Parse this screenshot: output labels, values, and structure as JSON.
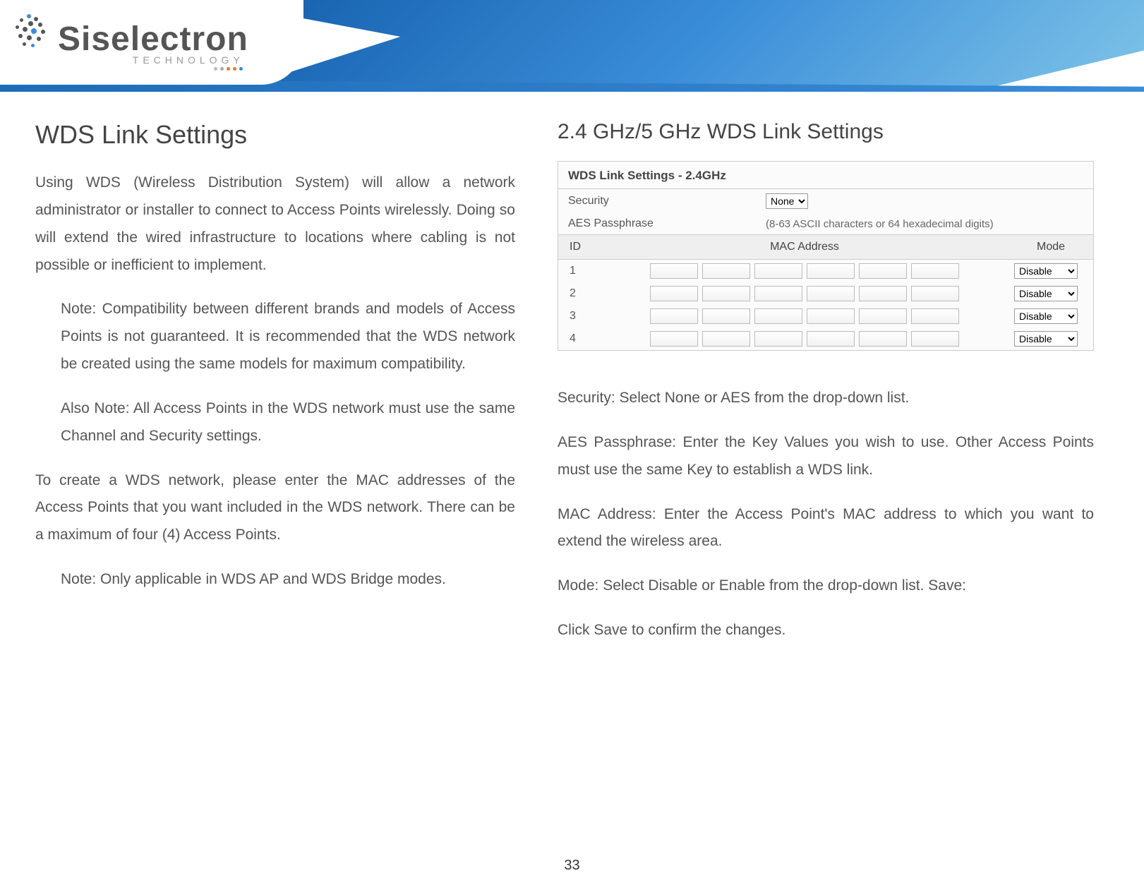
{
  "brand": {
    "name": "Siselectron",
    "tagline": "TECHNOLOGY"
  },
  "left": {
    "title": "WDS Link Settings",
    "p1": "Using   WDS  (Wireless    Distribution    System)    will  allow a    network administrator     or     installer      to      connect     to Access   Points wirelessly.    Doing   so    will extend  the    wired infrastructure  to locations where  cabling  is not  possible  or inefficient to implement.",
    "note1": "Note:    Compatibility   between  different  brands    and models of  Access  Points   is not  guaranteed. It is recommended that  the WDS  network  be  created using the  same  models  for maximum compatibility.",
    "note2": "Also  Note:   All  Access  Points  in the   WDS network must use  the same  Channel  and  Security  settings.",
    "p2": "To create a WDS network, please   enter   the   MAC addresses of  the Access  Points  that you  want   included   in the   WDS network.  There can be a maximum of four (4) Access Points.",
    "note3": "Note:  Only applicable  in WDS AP and WDS Bridge modes."
  },
  "right": {
    "title": "2.4  GHz/5  GHz WDS Link Settings",
    "panel_title": "WDS Link Settings - 2.4GHz",
    "security_label": "Security",
    "security_value": "None",
    "passphrase_label": "AES Passphrase",
    "passphrase_hint": "(8-63 ASCII characters or 64 hexadecimal digits)",
    "th_id": "ID",
    "th_mac": "MAC Address",
    "th_mode": "Mode",
    "rows": [
      {
        "id": "1",
        "mode": "Disable"
      },
      {
        "id": "2",
        "mode": "Disable"
      },
      {
        "id": "3",
        "mode": "Disable"
      },
      {
        "id": "4",
        "mode": "Disable"
      }
    ],
    "desc_security": "Security: Select  None  or AES from the  drop-down  list.",
    "desc_pass": "AES Passphrase:  Enter   the   Key Values   you   wish   to   use.  Other Access  Points  must  use  the  same  Key to establish a WDS link.",
    "desc_mac": "MAC Address:  Enter  the  Access  Point's  MAC address to which  you want  to extend the  wireless area.",
    "desc_mode": "Mode: Select  Disable or Enable from the  drop-down  list. Save:",
    "desc_save": "Click Save  to  confirm  the  changes."
  },
  "page_number": "33"
}
